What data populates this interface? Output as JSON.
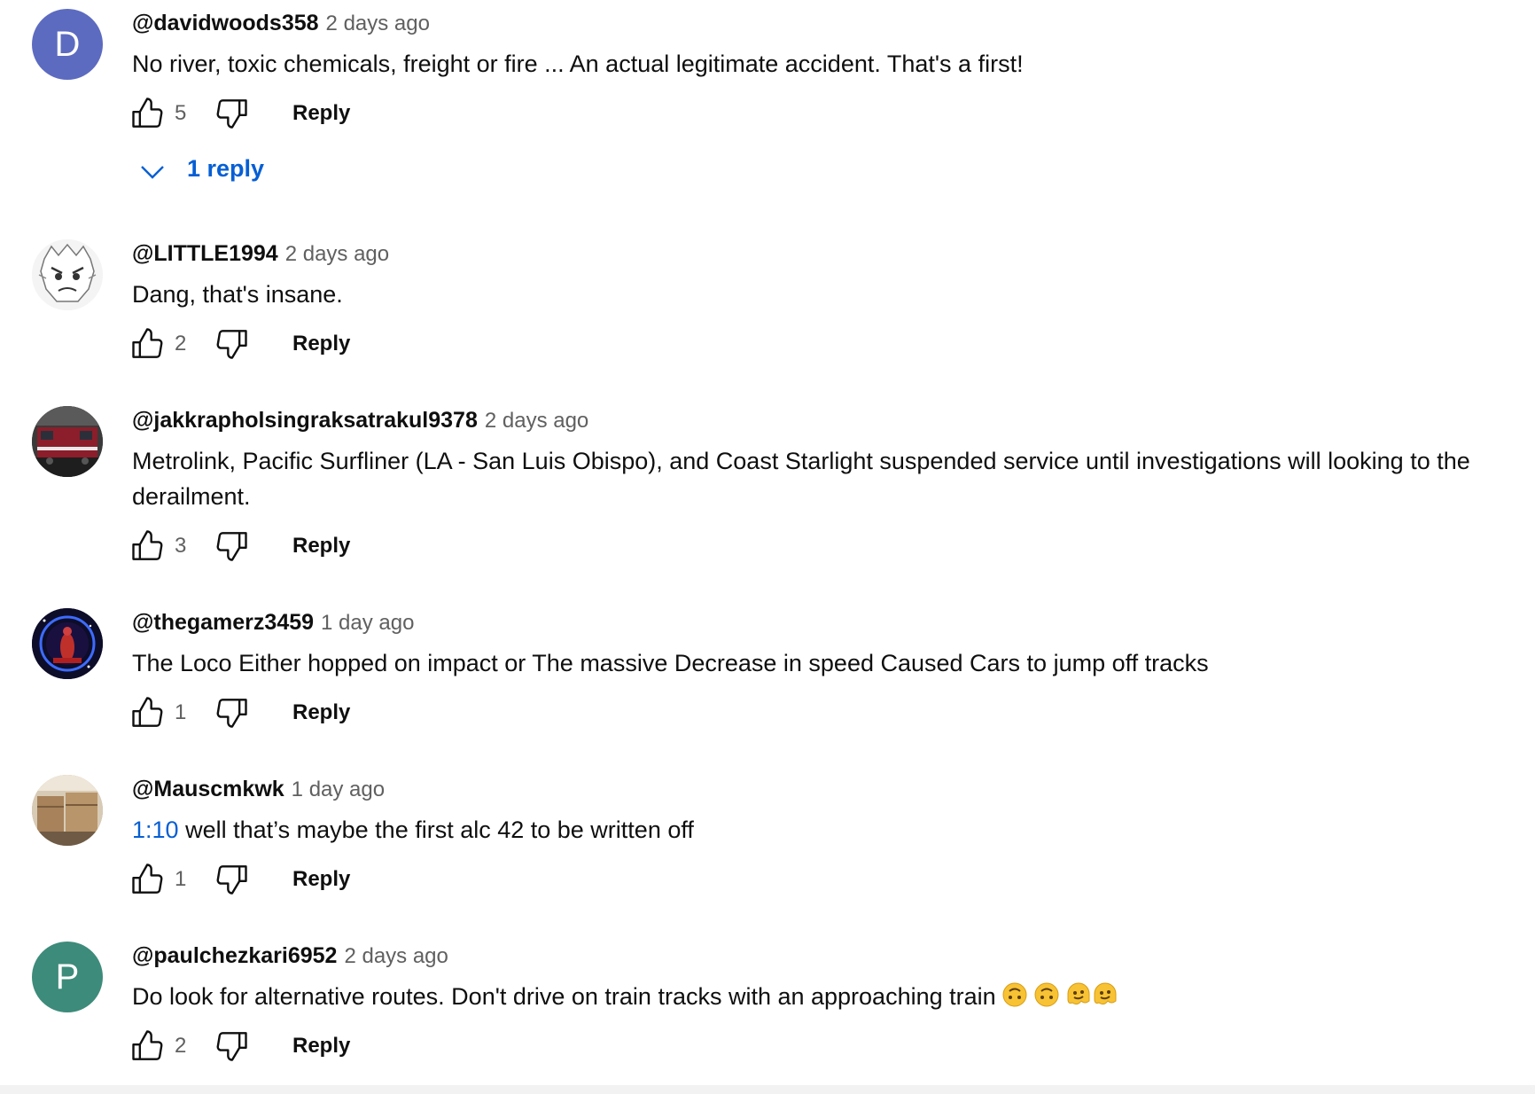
{
  "comments": [
    {
      "author": "@davidwoods358",
      "time": "2 days ago",
      "text": "No river, toxic chemicals, freight or fire ...  An actual legitimate accident.  That's a first!",
      "likes": "5",
      "reply_label": "Reply",
      "replies_label": "1 reply",
      "avatar_letter": "D",
      "avatar_color": "#5c6bc0"
    },
    {
      "author": "@LITTLE1994",
      "time": "2 days ago",
      "text": "Dang, that's insane.",
      "likes": "2",
      "reply_label": "Reply"
    },
    {
      "author": "@jakkrapholsingraksatrakul9378",
      "time": "2 days ago",
      "text": "Metrolink, Pacific Surfliner (LA - San Luis Obispo), and Coast Starlight suspended service until investigations will looking to the derailment.",
      "likes": "3",
      "reply_label": "Reply"
    },
    {
      "author": "@thegamerz3459",
      "time": "1 day ago",
      "text": "The Loco Either hopped on impact or The massive Decrease in speed Caused Cars to jump off tracks",
      "likes": "1",
      "reply_label": "Reply"
    },
    {
      "author": "@Mauscmkwk",
      "time": "1 day ago",
      "timestamp_link": "1:10",
      "text": "well that’s maybe the first alc 42 to be written off",
      "likes": "1",
      "reply_label": "Reply"
    },
    {
      "author": "@paulchezkari6952",
      "time": "2 days ago",
      "text": "Do look for alternative routes.  Don't drive on train tracks with an approaching train",
      "likes": "2",
      "reply_label": "Reply",
      "avatar_letter": "P",
      "avatar_color": "#3d8b7a"
    }
  ],
  "colors": {
    "link_blue": "#065fd4",
    "meta_gray": "#606060",
    "text": "#0f0f0f"
  },
  "icons": [
    "thumbs-up-icon",
    "thumbs-down-icon",
    "chevron-down-icon",
    "upside-down-face-emoji",
    "melting-face-emoji"
  ]
}
